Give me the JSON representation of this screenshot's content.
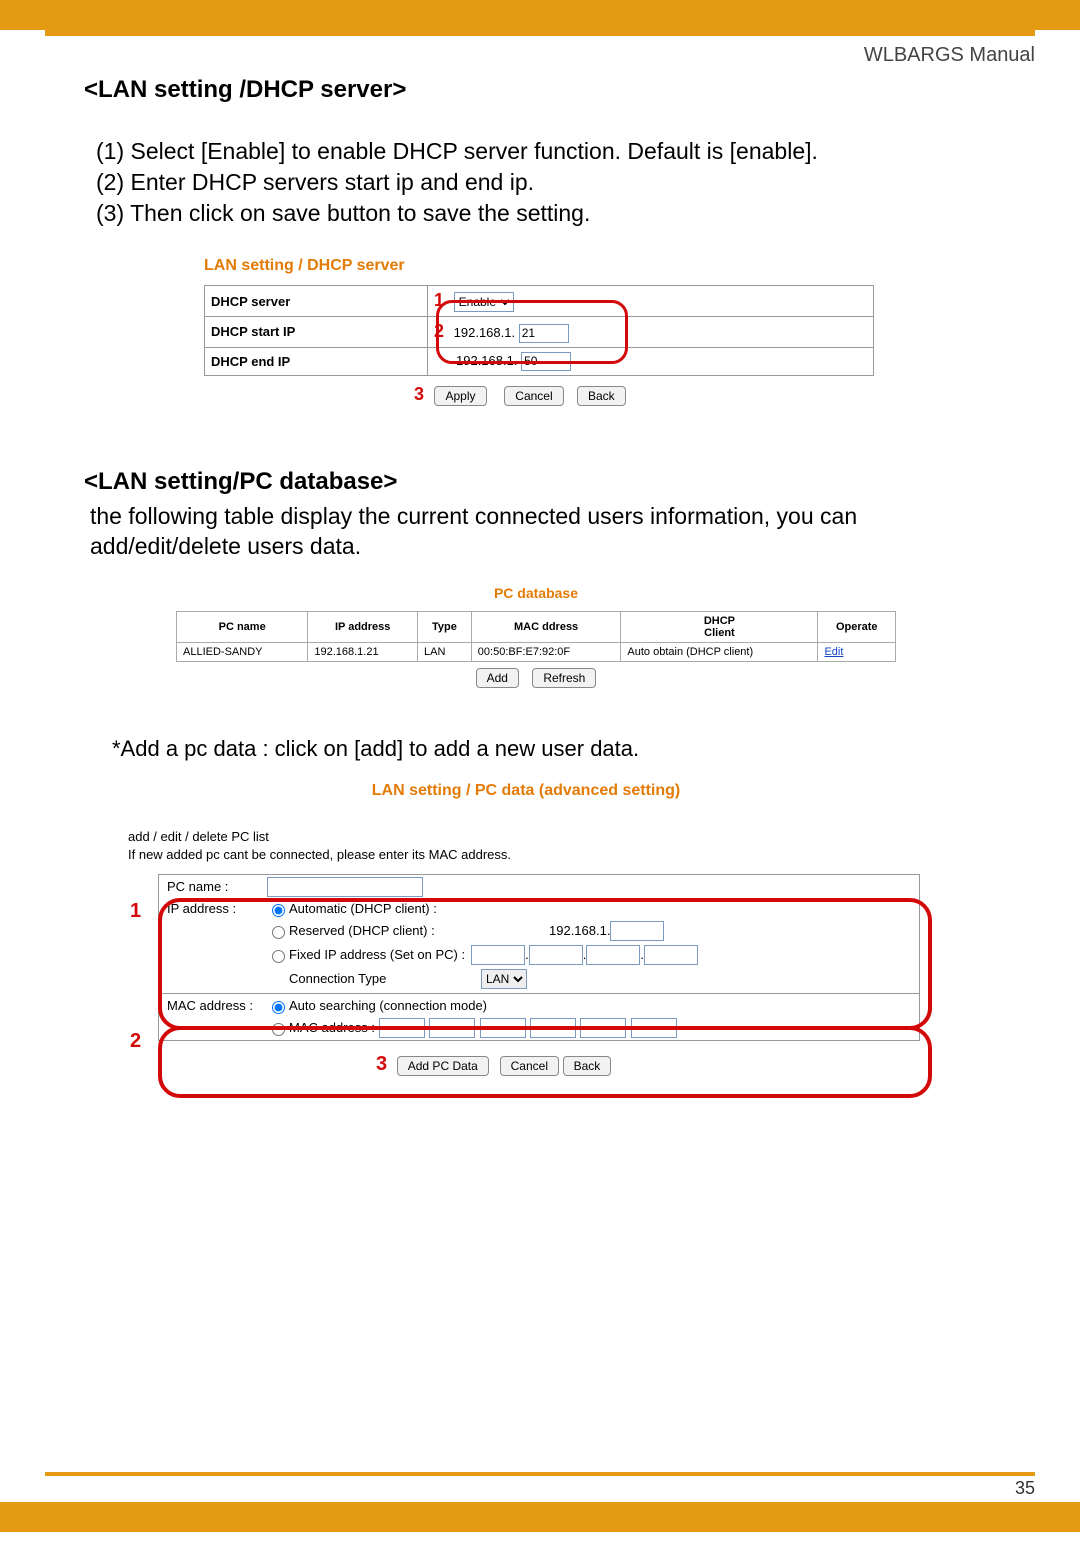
{
  "header_right": "WLBARGS Manual",
  "page_number": "35",
  "sec1": {
    "title": "<LAN setting /DHCP server>",
    "steps": [
      "(1) Select [Enable] to enable DHCP server function. Default is [enable].",
      "(2) Enter DHCP servers start ip and end ip.",
      "(3) Then click on save button to save the setting."
    ]
  },
  "fig1": {
    "caption": "LAN setting / DHCP server",
    "rows": [
      {
        "label": "DHCP server",
        "marker": "1",
        "type": "select",
        "value": "Enable"
      },
      {
        "label": "DHCP start IP",
        "marker": "2",
        "type": "ip",
        "prefix": "192.168.1.",
        "value": "21"
      },
      {
        "label": "DHCP end IP",
        "marker": "",
        "type": "ip",
        "prefix": "192.168.1.",
        "value": "50"
      }
    ],
    "btn_marker": "3",
    "buttons": [
      "Apply",
      "Cancel",
      "Back"
    ]
  },
  "sec2": {
    "title": "<LAN setting/PC database>",
    "desc": "the following table display the current connected users information, you can add/edit/delete users data."
  },
  "fig2": {
    "caption": "PC database",
    "headers": [
      "PC name",
      "IP address",
      "Type",
      "MAC ddress",
      "DHCP\nClient",
      "Operate"
    ],
    "row": [
      "ALLIED-SANDY",
      "192.168.1.21",
      "LAN",
      "00:50:BF:E7:92:0F",
      "Auto obtain (DHCP client)",
      "Edit"
    ],
    "buttons": [
      "Add",
      "Refresh"
    ]
  },
  "addline": "*Add a pc data : click on [add] to add a new user data.",
  "fig3": {
    "caption": "LAN setting / PC data (advanced setting)",
    "intro": [
      "add / edit / delete PC list",
      "If new added pc cant be connected, please enter its MAC address."
    ],
    "pc_name_label": "PC name :",
    "ip_label": "IP address :",
    "opt1": "Automatic (DHCP client) :",
    "opt2": "Reserved (DHCP client) :",
    "opt2_prefix": "192.168.1.",
    "opt3": "Fixed IP address (Set on PC) :",
    "conn_label": "Connection Type",
    "conn_value": "LAN",
    "mac_label": "MAC address :",
    "macopt1": "Auto searching (connection mode)",
    "macopt2": "MAC address :",
    "buttons": [
      "Add PC Data",
      "Cancel",
      "Back"
    ],
    "markers": {
      "a": "1",
      "b": "2",
      "c": "3"
    }
  }
}
